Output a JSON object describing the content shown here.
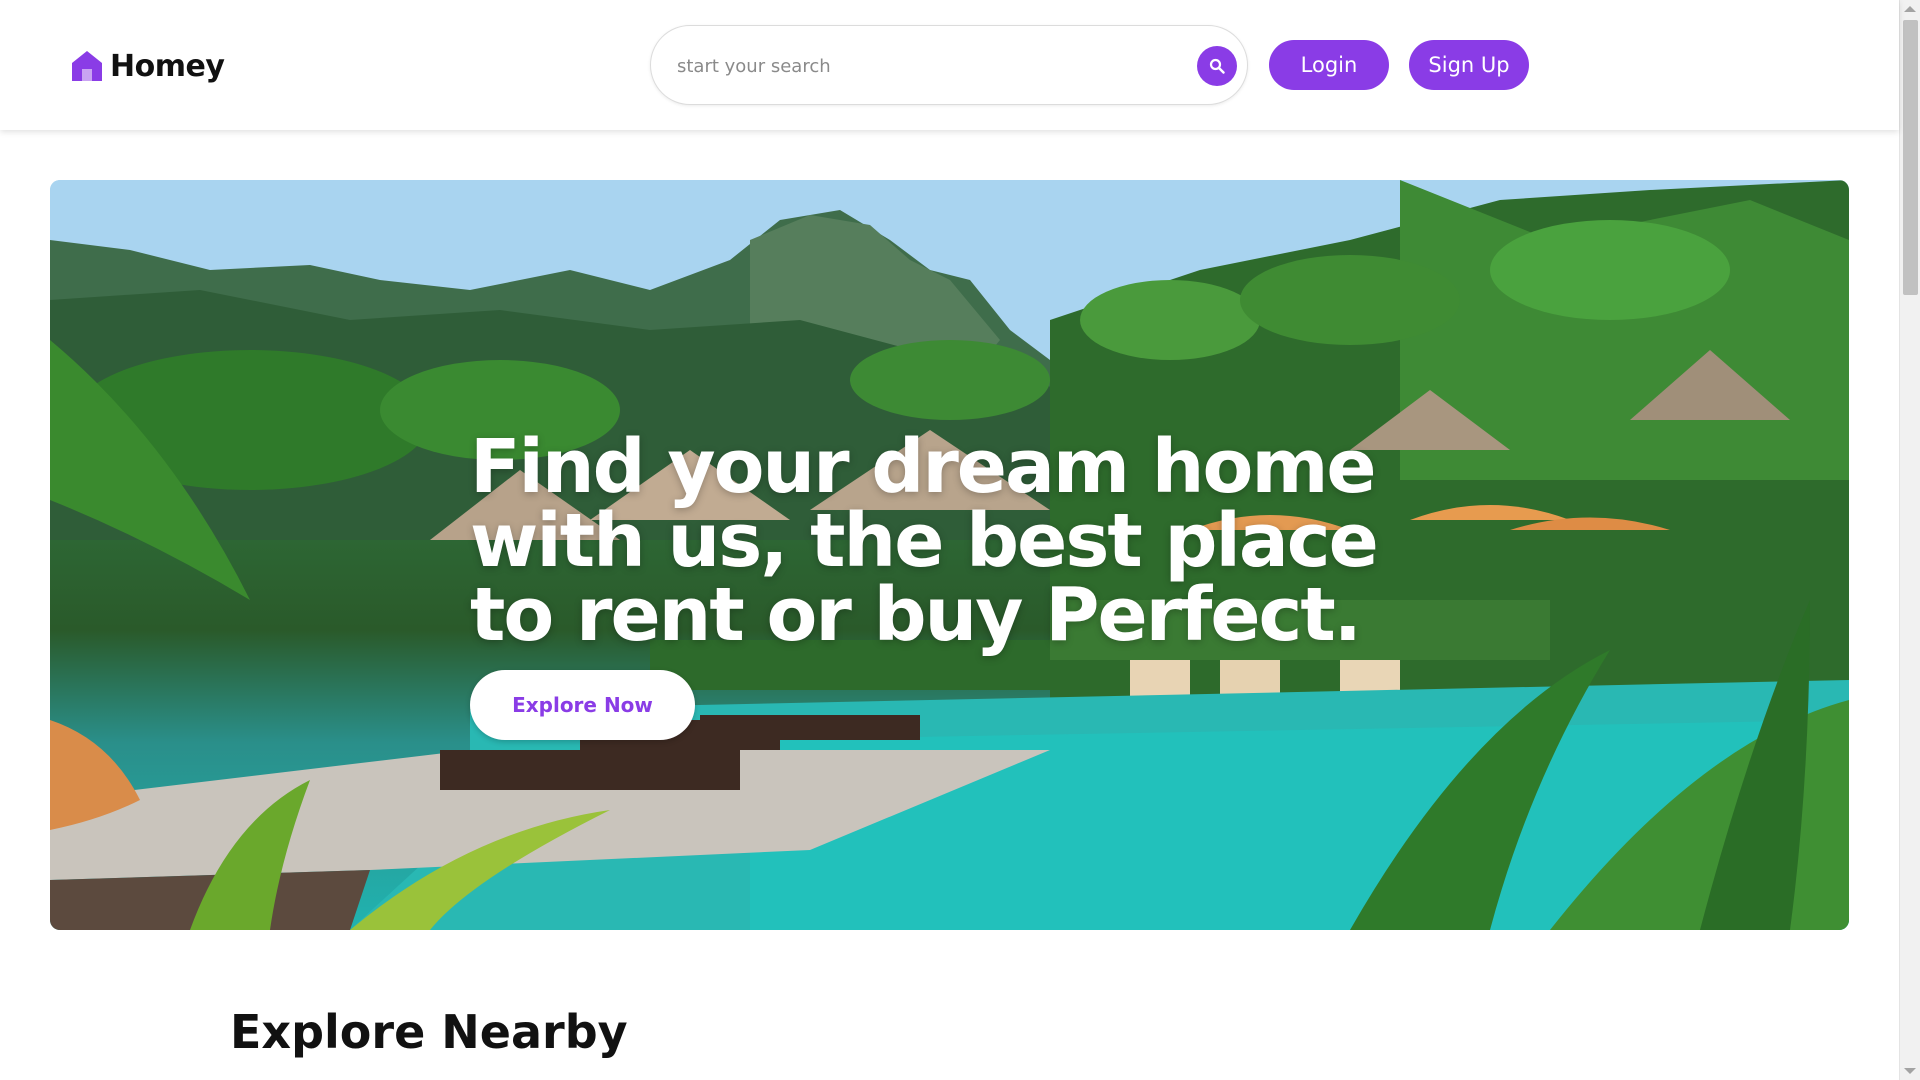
{
  "brand": {
    "name": "Homey",
    "accent": "#8a3ce6"
  },
  "header": {
    "search": {
      "placeholder": "start your search",
      "icon": "search-icon"
    },
    "login_label": "Login",
    "signup_label": "Sign Up"
  },
  "hero": {
    "title": "Find your dream home with us, the best place to rent or buy Perfect.",
    "cta_label": "Explore Now"
  },
  "sections": {
    "explore_nearby_title": "Explore Nearby"
  }
}
